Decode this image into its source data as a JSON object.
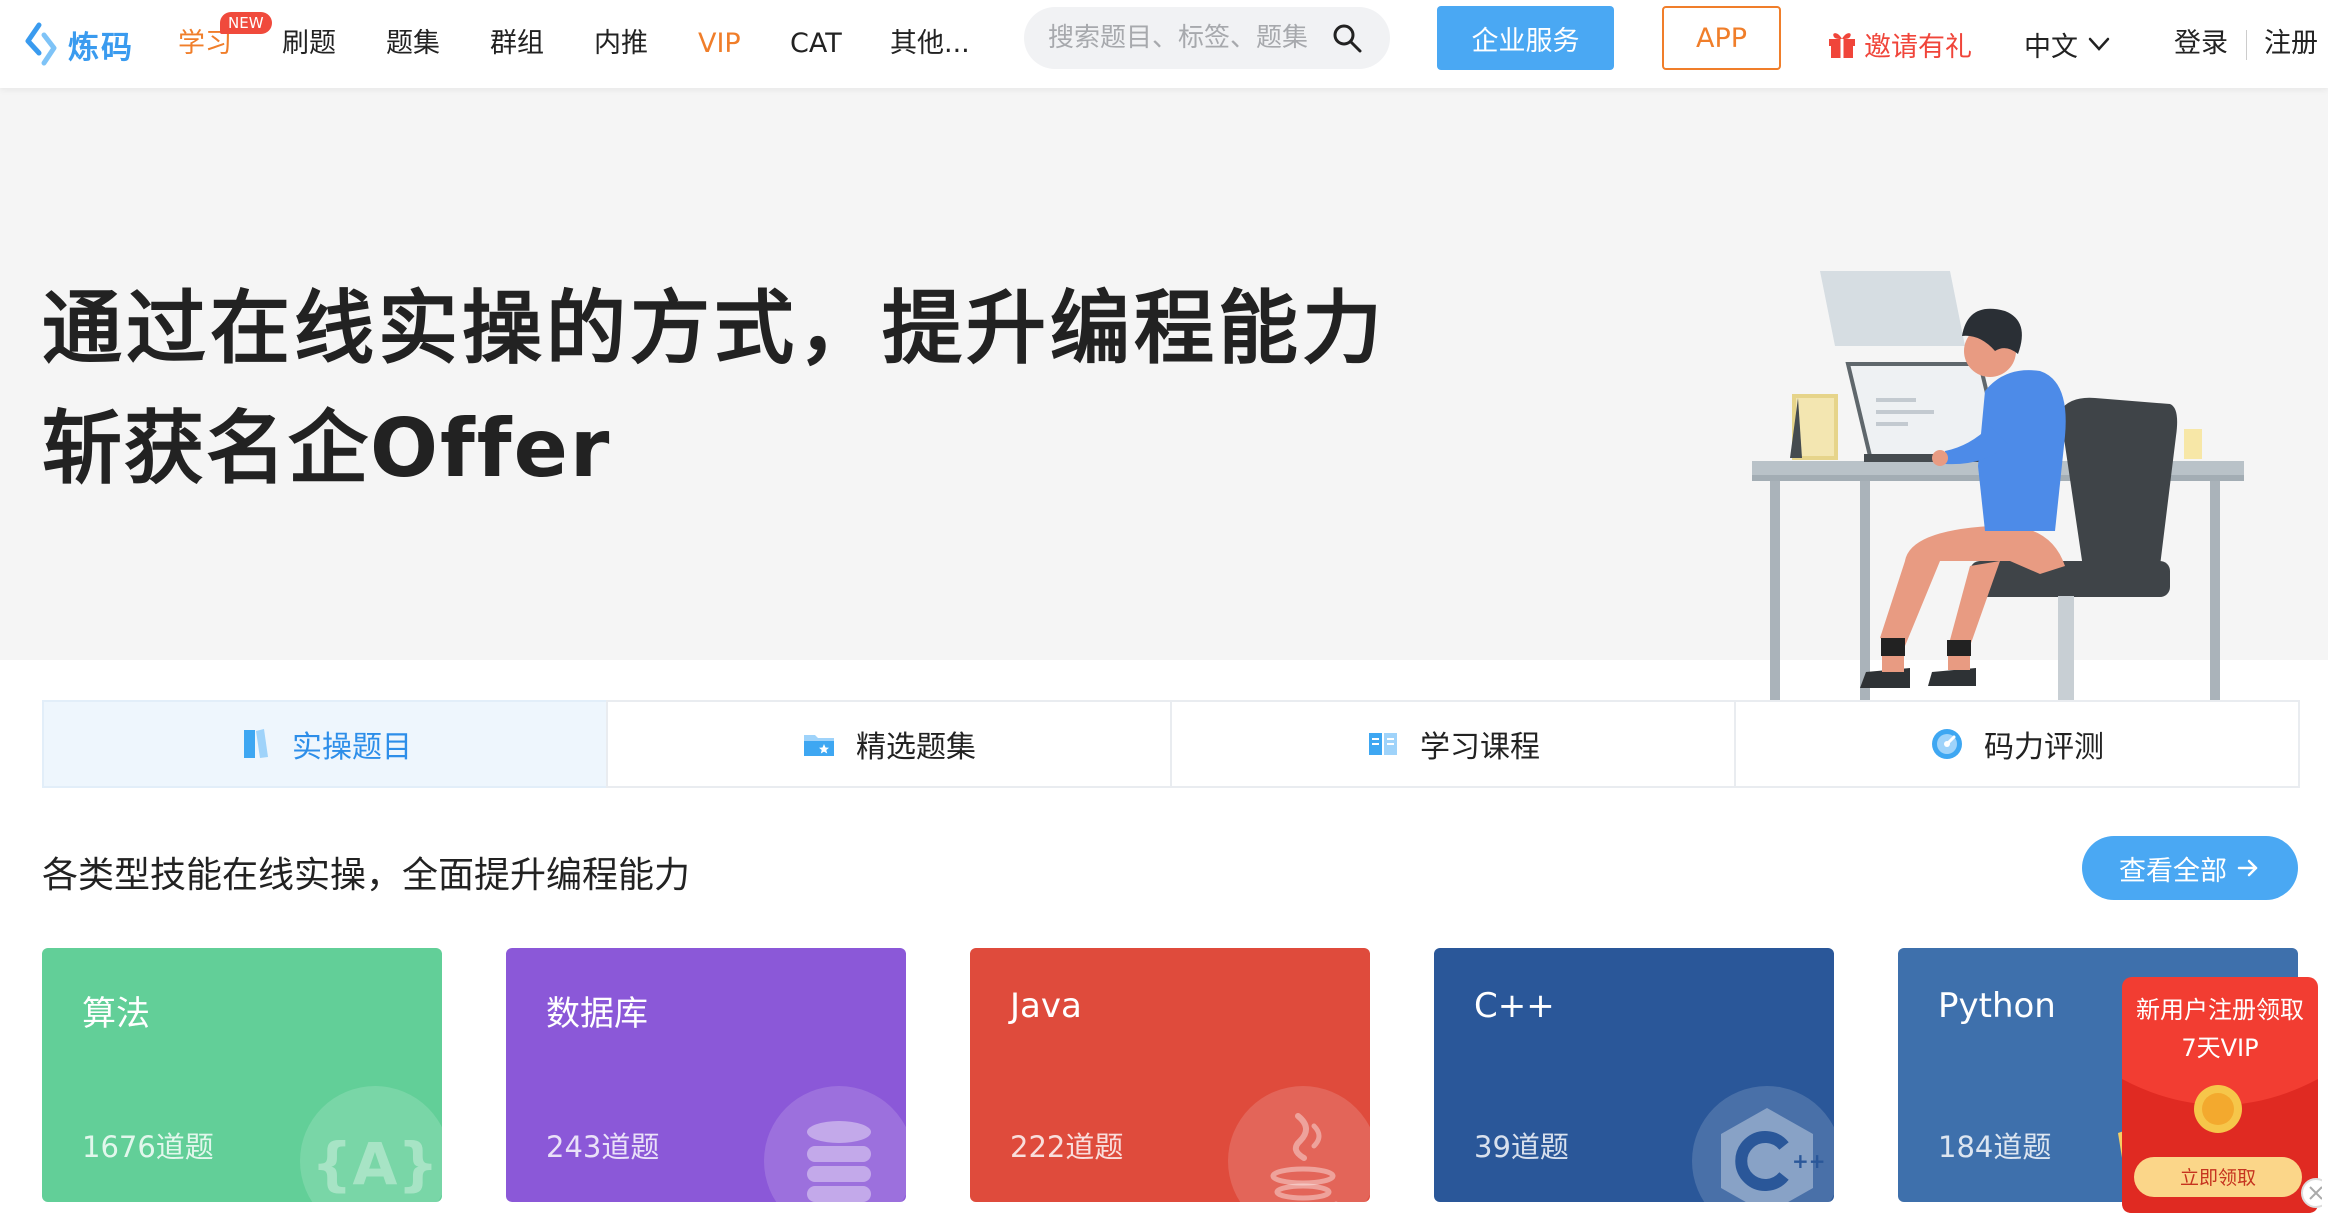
{
  "header": {
    "logo_text": "炼码",
    "nav": [
      {
        "label": "学习",
        "badge": "NEW"
      },
      {
        "label": "刷题"
      },
      {
        "label": "题集"
      },
      {
        "label": "群组"
      },
      {
        "label": "内推"
      },
      {
        "label": "VIP"
      },
      {
        "label": "CAT"
      },
      {
        "label": "其他..."
      }
    ],
    "search_placeholder": "搜索题目、标签、题集",
    "enterprise_button": "企业服务",
    "app_button": "APP",
    "invite_label": "邀请有礼",
    "language": "中文",
    "login": "登录",
    "register": "注册"
  },
  "hero": {
    "line1": "通过在线实操的方式，提升编程能力",
    "line2": "斩获名企Offer"
  },
  "tabs": [
    {
      "label": "实操题目",
      "active": true
    },
    {
      "label": "精选题集",
      "active": false
    },
    {
      "label": "学习课程",
      "active": false
    },
    {
      "label": "码力评测",
      "active": false
    }
  ],
  "section": {
    "title": "各类型技能在线实操，全面提升编程能力",
    "view_all": "查看全部"
  },
  "cards": [
    {
      "title": "算法",
      "count": "1676道题",
      "color": "#62cf98",
      "icon": "algorithm-icon"
    },
    {
      "title": "数据库",
      "count": "243道题",
      "color": "#8b58d8",
      "icon": "database-icon"
    },
    {
      "title": "Java",
      "count": "222道题",
      "color": "#df4b3c",
      "icon": "java-icon"
    },
    {
      "title": "C++",
      "count": "39道题",
      "color": "#2a5799",
      "icon": "cpp-icon"
    },
    {
      "title": "Python",
      "count": "184道题",
      "color": "#3e70ac",
      "icon": "python-icon"
    }
  ],
  "promo": {
    "line1": "新用户注册领取",
    "line2": "7天VIP",
    "button": "立即领取"
  },
  "colors": {
    "accent": "#4aa8f3",
    "orange": "#f07e2a",
    "red": "#f0453a"
  }
}
